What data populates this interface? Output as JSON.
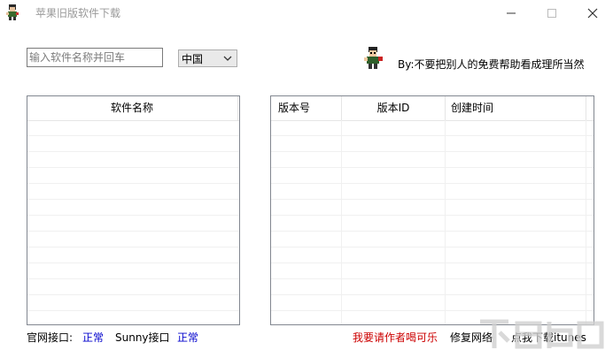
{
  "window": {
    "title": "苹果旧版软件下载",
    "minimize_icon": "minimize-icon",
    "maximize_icon": "maximize-icon",
    "close_icon": "close-icon"
  },
  "search": {
    "placeholder": "输入软件名称并回车",
    "value": ""
  },
  "region_select": {
    "selected": "中国"
  },
  "byline": "By:不要把别人的免费帮助看成理所当然",
  "left_list": {
    "header": "软件名称",
    "rows": []
  },
  "right_list": {
    "columns": [
      "版本号",
      "版本ID",
      "创建时间"
    ],
    "rows": []
  },
  "status": {
    "official_label": "官网接口:",
    "official_status": "正常",
    "sunny_label": "Sunny接口",
    "sunny_status": "正常"
  },
  "actions": {
    "buy_coke": "我要请作者喝可乐",
    "repair_network": "修复网络",
    "download_itunes": "点我下载itunes"
  },
  "colors": {
    "link_blue": "#0000cc",
    "link_red": "#cc0000",
    "title_gray": "#9a9a9a"
  }
}
